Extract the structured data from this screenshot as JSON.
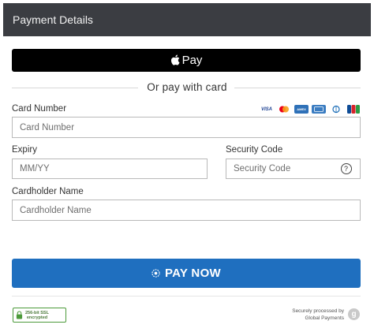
{
  "header": {
    "title": "Payment Details"
  },
  "apple_pay": {
    "label": "Pay"
  },
  "divider": {
    "label": "Or pay with card"
  },
  "card_number": {
    "label": "Card Number",
    "placeholder": "Card Number",
    "value": ""
  },
  "card_brands": {
    "visa": "VISA",
    "amex": "AMEX",
    "jcb": "JCB"
  },
  "expiry": {
    "label": "Expiry",
    "placeholder": "MM/YY",
    "value": ""
  },
  "security_code": {
    "label": "Security Code",
    "placeholder": "Security Code",
    "value": "",
    "help": "?"
  },
  "cardholder_name": {
    "label": "Cardholder Name",
    "placeholder": "Cardholder Name",
    "value": ""
  },
  "pay_button": {
    "label": "PAY NOW"
  },
  "ssl_badge": {
    "line1": "256-bit SSL",
    "line2": "encrypted"
  },
  "processor": {
    "line1": "Securely processed by",
    "line2": "Global Payments",
    "logo_letter": "g"
  },
  "colors": {
    "header_bg": "#3b3d42",
    "pay_button_bg": "#1f6fbf",
    "apple_pay_bg": "#000000",
    "ssl_green": "#4c9a3a"
  }
}
